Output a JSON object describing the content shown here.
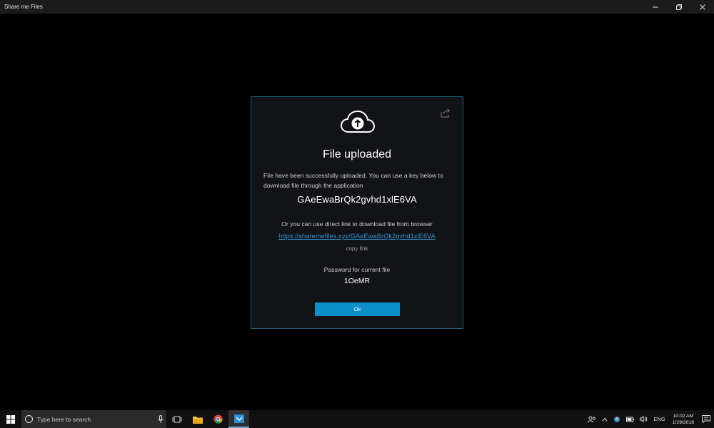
{
  "window": {
    "title": "Share me Files",
    "minimize_glyph": "—",
    "restore_glyph": "❐",
    "close_glyph": "✕"
  },
  "dialog": {
    "icons": {
      "cloud": "cloud-upload-icon",
      "share": "share-icon"
    },
    "title": "File uploaded",
    "message": "File have been successfully uploaded. You can use a key below to download file through the application",
    "key": "GAeEwaBrQk2gvhd1xlE6VA",
    "or_text": "Or you can use direct link to download file from browser",
    "link": "https://sharemefiles.xyz/GAeEwaBrQk2gvhd1xlE6VA",
    "copy_link": "copy link",
    "password_label": "Password for current file",
    "password": "1OeMR",
    "ok_label": "Ok"
  },
  "taskbar": {
    "search_placeholder": "Type here to search",
    "apps": [
      "task-view-icon",
      "file-explorer-icon",
      "chrome-icon",
      "share-me-files-icon"
    ],
    "tray": {
      "language": "ENG",
      "time": "10:02 AM",
      "date": "1/29/2018"
    }
  },
  "colors": {
    "accent": "#0b8fc9",
    "dialog_border": "#1f5e7a",
    "link": "#2d8fd0",
    "dialog_bg": "#121317"
  }
}
